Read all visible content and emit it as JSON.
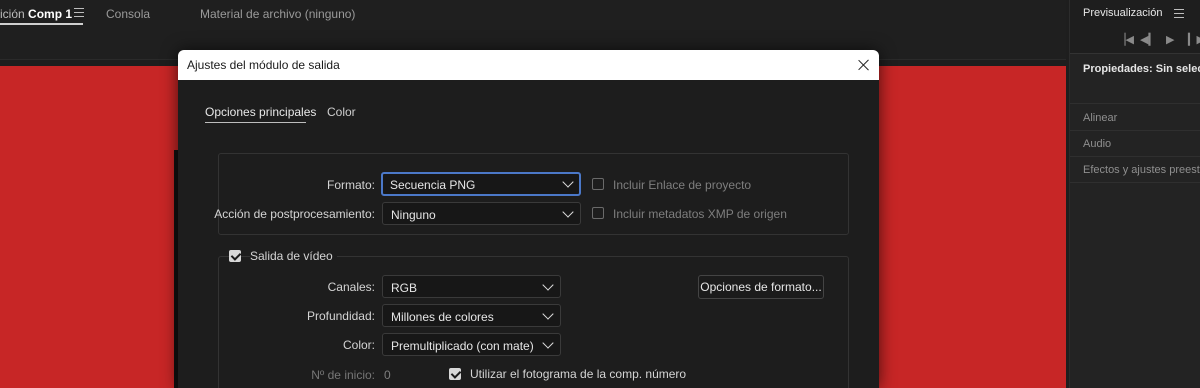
{
  "top_tabs": {
    "comp_prefix": "ición",
    "comp_name": "Comp 1",
    "console": "Consola",
    "footage": "Material de archivo (ninguno)"
  },
  "right_panel": {
    "preview_title": "Previsualización",
    "properties_title": "Propiedades: Sin selección",
    "items": [
      "Alinear",
      "Audio",
      "Efectos y ajustes preestablecidos"
    ],
    "transport": [
      "first-frame-icon",
      "prev-frame-icon",
      "play-icon",
      "next-frame-icon"
    ]
  },
  "dialog": {
    "title": "Ajustes del módulo de salida",
    "tabs": [
      "Opciones principales",
      "Color"
    ],
    "format_label": "Formato:",
    "format_value": "Secuencia PNG",
    "post_label": "Acción de postprocesamiento:",
    "post_value": "Ninguno",
    "include_project_link": "Incluir Enlace de proyecto",
    "include_xmp": "Incluir metadatos XMP de origen",
    "video_output": "Salida de vídeo",
    "video_output_checked": true,
    "channels_label": "Canales:",
    "channels_value": "RGB",
    "depth_label": "Profundidad:",
    "depth_value": "Millones de colores",
    "color_label": "Color:",
    "color_value": "Premultiplicado (con mate)",
    "format_options_button": "Opciones de formato...",
    "start_label": "Nº de inicio:",
    "start_value": "0",
    "use_comp_frame": "Utilizar el fotograma de la comp. número",
    "use_comp_frame_checked": true
  },
  "colors": {
    "composition_bg": "#c72626",
    "focus_ring": "#4b78c8"
  }
}
